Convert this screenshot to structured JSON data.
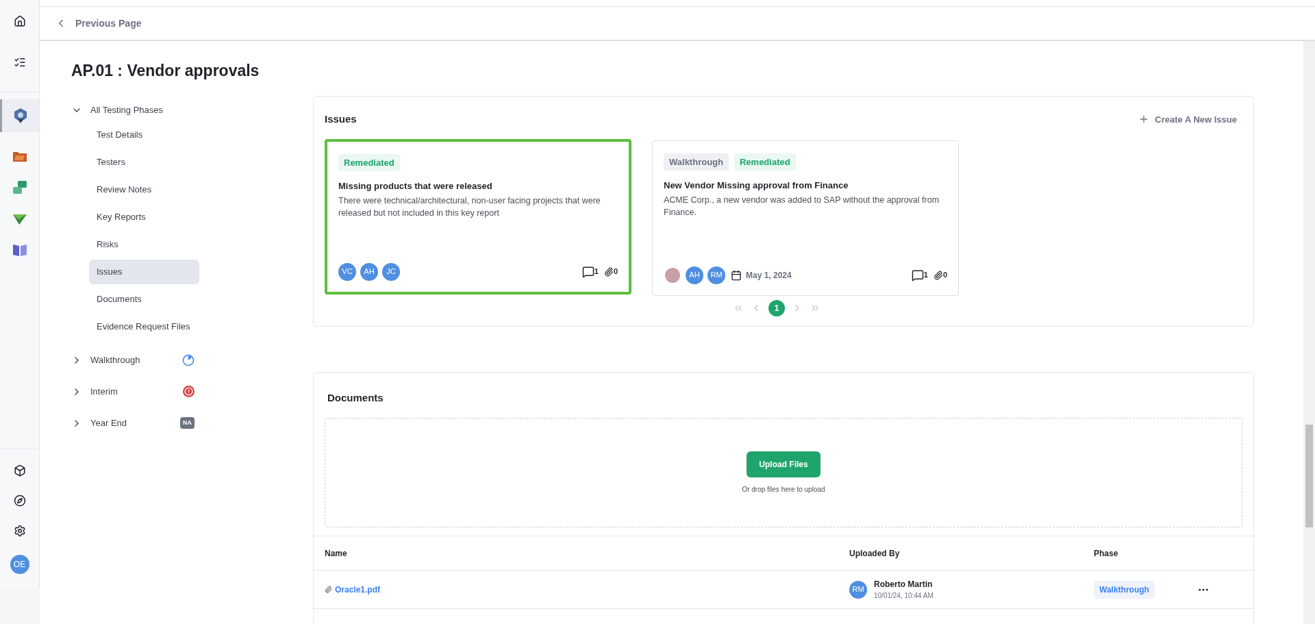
{
  "header": {
    "back_label": "Previous Page"
  },
  "title": "AP.01 : Vendor approvals",
  "user": {
    "initials": "OE"
  },
  "nav": {
    "group": {
      "label": "All Testing Phases",
      "expanded": true
    },
    "items": [
      {
        "label": "Test Details",
        "selected": false
      },
      {
        "label": "Testers",
        "selected": false
      },
      {
        "label": "Review Notes",
        "selected": false
      },
      {
        "label": "Key Reports",
        "selected": false
      },
      {
        "label": "Risks",
        "selected": false
      },
      {
        "label": "Issues",
        "selected": true
      },
      {
        "label": "Documents",
        "selected": false
      },
      {
        "label": "Evidence Request Files",
        "selected": false
      }
    ],
    "phases": [
      {
        "label": "Walkthrough",
        "expanded": false,
        "kind": "progress"
      },
      {
        "label": "Interim",
        "expanded": false,
        "kind": "alert"
      },
      {
        "label": "Year End",
        "expanded": false,
        "kind": "na",
        "badge": "NA"
      }
    ]
  },
  "issues": {
    "title": "Issues",
    "create_label": "Create A New Issue",
    "cards": [
      {
        "selected": true,
        "tags": [
          {
            "label": "Remediated",
            "kind": "status"
          }
        ],
        "title": "Missing products that were released",
        "description": "There were technical/architectural, non-user facing projects that were released but not included in this key report",
        "assignees": [
          {
            "kind": "initials",
            "initials": "VC"
          },
          {
            "kind": "initials",
            "initials": "AH"
          },
          {
            "kind": "initials",
            "initials": "JC"
          }
        ],
        "comments": "1",
        "attachments": "0"
      },
      {
        "selected": false,
        "tags": [
          {
            "label": "Walkthrough",
            "kind": "phase"
          },
          {
            "label": "Remediated",
            "kind": "status"
          }
        ],
        "title": "New Vendor Missing approval from Finance",
        "description": "ACME Corp., a new vendor was added to SAP without the approval from Finance.",
        "assignees": [
          {
            "kind": "photo"
          },
          {
            "kind": "initials",
            "initials": "AH"
          },
          {
            "kind": "initials",
            "initials": "RM"
          }
        ],
        "date": "May 1, 2024",
        "comments": "1",
        "attachments": "0"
      }
    ],
    "pages": [
      {
        "label": "1",
        "selected": true
      }
    ]
  },
  "documents": {
    "title": "Documents",
    "upload_label": "Upload Files",
    "drop_hint": "Or drop files here to upload",
    "columns": [
      "Name",
      "Uploaded By",
      "Phase"
    ],
    "rows": [
      {
        "name": "Oracle1.pdf",
        "uploader_initials": "RM",
        "uploader": "Roberto Martin",
        "uploaded_at": "10/01/24, 10:44 AM",
        "phase": "Walkthrough"
      }
    ]
  }
}
